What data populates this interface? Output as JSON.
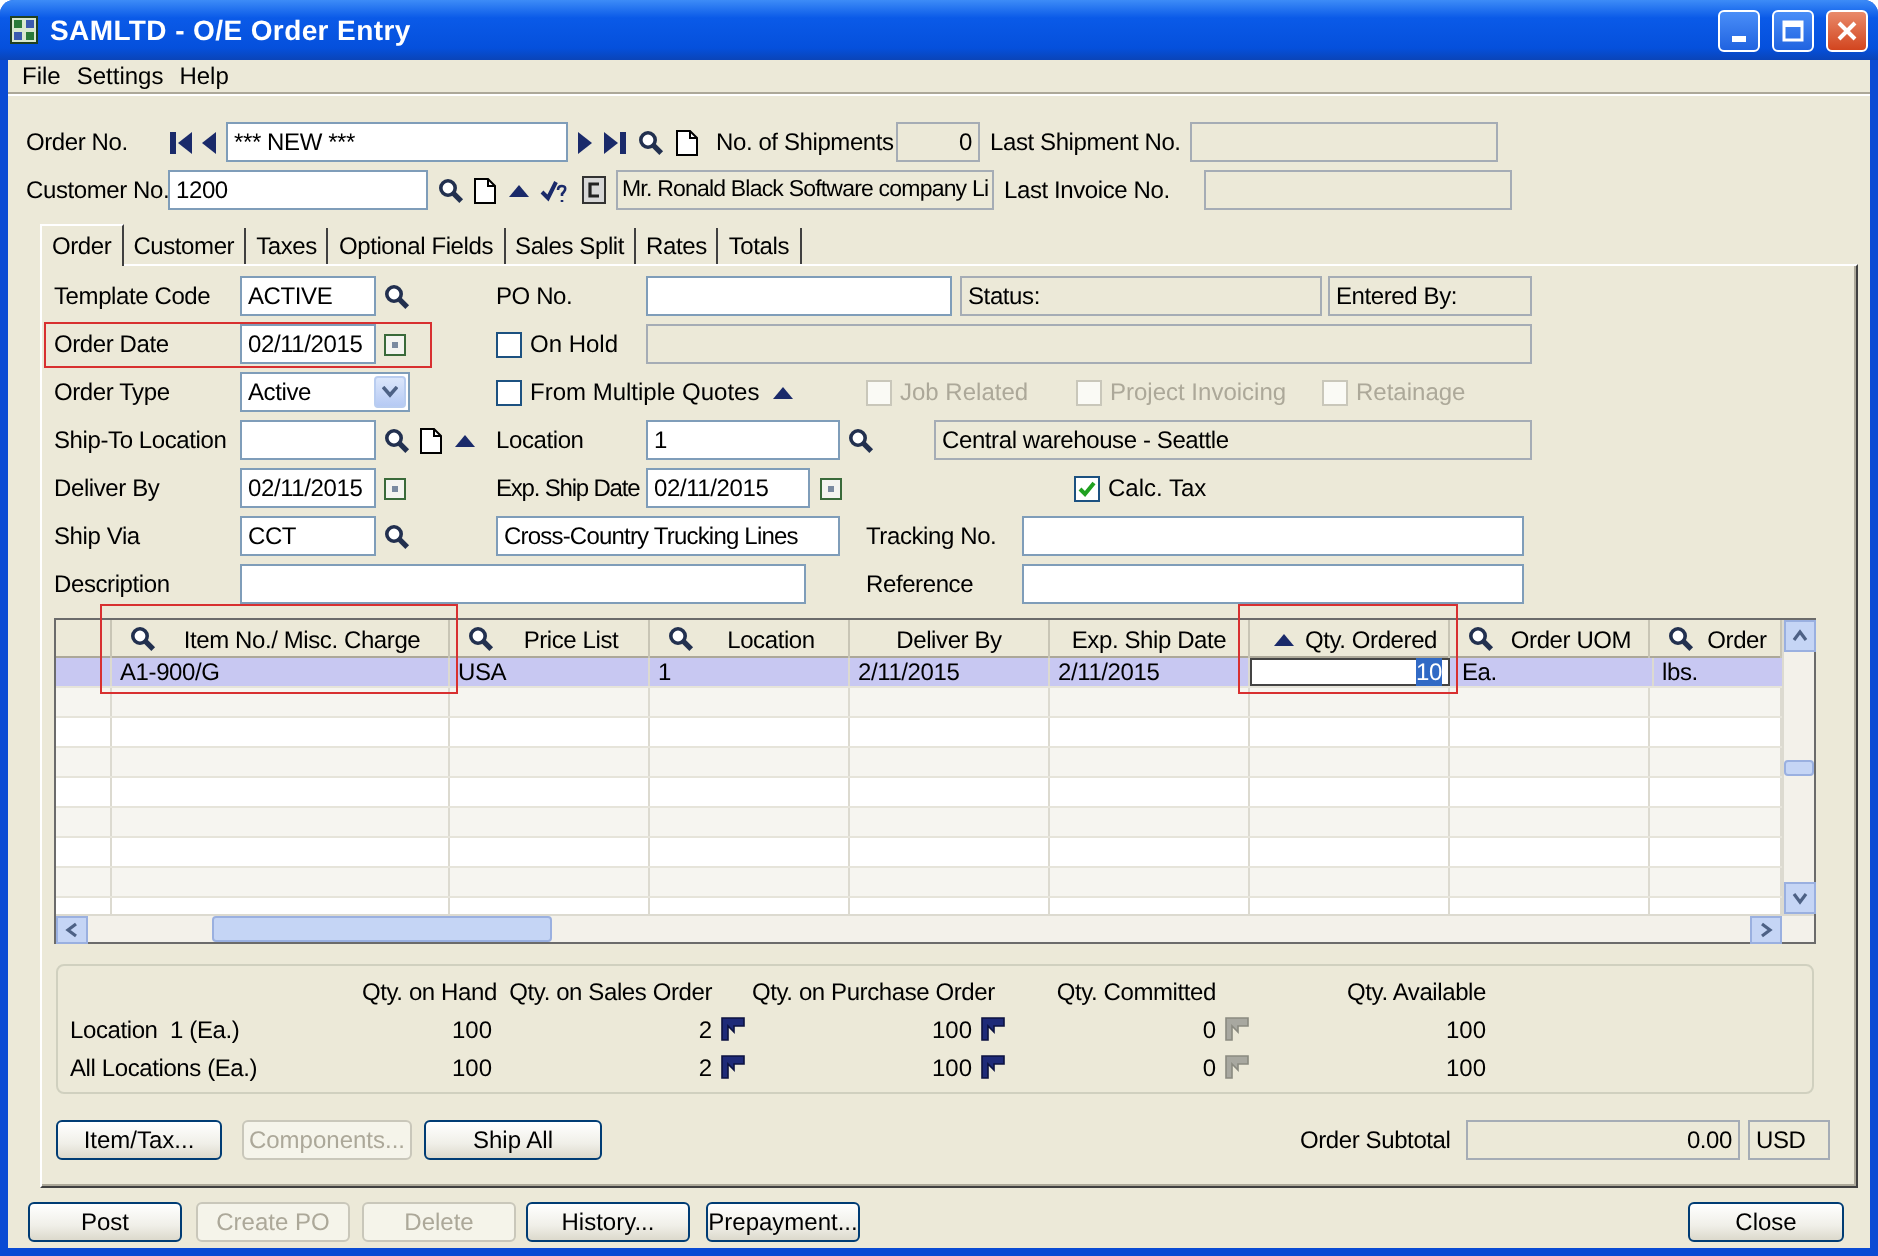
{
  "window": {
    "title": "SAMLTD - O/E Order Entry"
  },
  "menu": [
    "File",
    "Settings",
    "Help"
  ],
  "header": {
    "order_no": {
      "label": "Order No.",
      "value": "*** NEW ***"
    },
    "shipments": {
      "label": "No. of Shipments",
      "value": "0"
    },
    "last_shipment": {
      "label": "Last Shipment No."
    },
    "customer_no": {
      "label": "Customer No.",
      "value": "1200"
    },
    "customer_name": "Mr. Ronald Black Software company Li",
    "last_invoice": {
      "label": "Last Invoice No."
    }
  },
  "tabs": [
    {
      "label": "Order",
      "selected": true
    },
    {
      "label": "Customer",
      "selected": false
    },
    {
      "label": "Taxes",
      "selected": false
    },
    {
      "label": "Optional Fields",
      "selected": false
    },
    {
      "label": "Sales Split",
      "selected": false
    },
    {
      "label": "Rates",
      "selected": false
    },
    {
      "label": "Totals",
      "selected": false
    }
  ],
  "order_form": {
    "template_code": {
      "label": "Template Code",
      "value": "ACTIVE"
    },
    "po_no": {
      "label": "PO No."
    },
    "status": "Status:",
    "entered_by": "Entered By:",
    "order_date": {
      "label": "Order Date",
      "value": "02/11/2015",
      "highlighted": true
    },
    "on_hold": {
      "label": "On Hold",
      "checked": false,
      "disabled": false
    },
    "order_type": {
      "label": "Order Type",
      "value": "Active"
    },
    "from_multiple_quotes": {
      "label": "From Multiple Quotes",
      "checked": false,
      "disabled": false
    },
    "job_related": {
      "label": "Job Related",
      "checked": false,
      "disabled": true
    },
    "project_invoicing": {
      "label": "Project Invoicing",
      "checked": false,
      "disabled": true
    },
    "retainage": {
      "label": "Retainage",
      "checked": false,
      "disabled": true
    },
    "ship_to_location": {
      "label": "Ship-To Location"
    },
    "location": {
      "label": "Location",
      "value": "1",
      "description": "Central warehouse - Seattle"
    },
    "deliver_by": {
      "label": "Deliver By",
      "value": "02/11/2015"
    },
    "exp_ship_date": {
      "label": "Exp. Ship Date",
      "value": "02/11/2015"
    },
    "calc_tax": {
      "label": "Calc. Tax",
      "checked": true,
      "disabled": false
    },
    "ship_via": {
      "label": "Ship Via",
      "value": "CCT",
      "description": "Cross-Country Trucking Lines"
    },
    "tracking_no": {
      "label": "Tracking No."
    },
    "description": {
      "label": "Description"
    },
    "reference": {
      "label": "Reference"
    }
  },
  "lines": {
    "columns": [
      {
        "label": "Item No./ Misc. Charge",
        "kind": "finder",
        "highlighted": true
      },
      {
        "label": "Price List",
        "kind": "finder",
        "highlighted": false
      },
      {
        "label": "Location",
        "kind": "finder",
        "highlighted": false
      },
      {
        "label": "Deliver By",
        "kind": "plain",
        "highlighted": false
      },
      {
        "label": "Exp. Ship Date",
        "kind": "plain",
        "highlighted": false
      },
      {
        "label": "Qty. Ordered",
        "kind": "sorted",
        "highlighted": true
      },
      {
        "label": "Order UOM",
        "kind": "finder",
        "highlighted": false
      },
      {
        "label": "Order",
        "kind": "finder",
        "highlighted": false
      }
    ],
    "rows": [
      {
        "selected": true,
        "cells": [
          {
            "text": "A1-900/G",
            "editing": false
          },
          {
            "text": "USA",
            "editing": false
          },
          {
            "text": "1",
            "editing": false
          },
          {
            "text": "2/11/2015",
            "editing": false
          },
          {
            "text": "2/11/2015",
            "editing": false
          },
          {
            "text": "10",
            "editing": true
          },
          {
            "text": "Ea.",
            "editing": false
          },
          {
            "text": "lbs.",
            "editing": false
          }
        ]
      }
    ]
  },
  "quantities": {
    "columns": [
      "Qty. on Hand",
      "Qty. on Sales Order",
      "Qty. on Purchase Order",
      "Qty. Committed",
      "Qty. Available"
    ],
    "rows": [
      {
        "label": "Location  1 (Ea.)",
        "cells": [
          {
            "text": "100",
            "kind": "plain"
          },
          {
            "text": "2",
            "kind": "drill",
            "disabled": false
          },
          {
            "text": "100",
            "kind": "drill",
            "disabled": false
          },
          {
            "text": "0",
            "kind": "drill",
            "disabled": true
          },
          {
            "text": "100",
            "kind": "plain"
          }
        ]
      },
      {
        "label": "All Locations (Ea.)",
        "cells": [
          {
            "text": "100",
            "kind": "plain"
          },
          {
            "text": "2",
            "kind": "drill",
            "disabled": false
          },
          {
            "text": "100",
            "kind": "drill",
            "disabled": false
          },
          {
            "text": "0",
            "kind": "drill",
            "disabled": true
          },
          {
            "text": "100",
            "kind": "plain"
          }
        ]
      }
    ]
  },
  "actions": [
    {
      "label": "Item/Tax...",
      "disabled": false
    },
    {
      "label": "Components...",
      "disabled": true
    },
    {
      "label": "Ship All",
      "disabled": false
    }
  ],
  "subtotal": {
    "label": "Order Subtotal",
    "value": "0.00",
    "currency": "USD"
  },
  "footer_buttons": [
    {
      "label": "Post",
      "disabled": false
    },
    {
      "label": "Create PO",
      "disabled": true
    },
    {
      "label": "Delete",
      "disabled": true
    },
    {
      "label": "History...",
      "disabled": false
    },
    {
      "label": "Prepayment...",
      "disabled": false
    }
  ],
  "close_button": {
    "label": "Close",
    "disabled": false
  }
}
